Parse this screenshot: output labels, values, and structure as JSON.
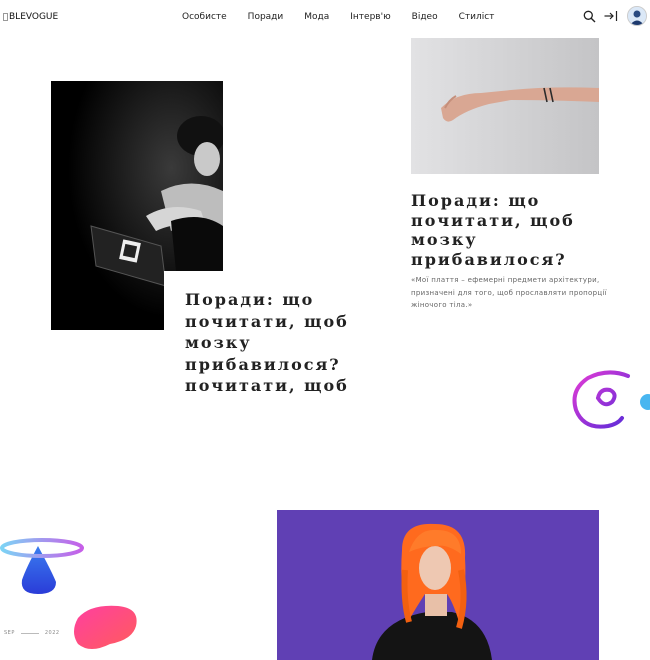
{
  "header": {
    "logo_alt": "BLEVOGUE",
    "nav": [
      "Особисте",
      "Поради",
      "Мода",
      "Інтерв'ю",
      "Відео",
      "Стиліст"
    ],
    "icons": [
      "search-icon",
      "login-icon",
      "avatar"
    ]
  },
  "articles": [
    {
      "title_lines": [
        "Поради: що",
        "почитати, щоб",
        "мозку",
        "прибавилося?",
        "почитати, щоб"
      ]
    },
    {
      "title_lines": [
        "Поради: що",
        "почитати, щоб",
        "мозку",
        "прибавилося?"
      ],
      "description": "«Мої плаття – ефемерні предмети архітектури, призначені для того, щоб прославляти пропорції жіночого тіла.»"
    }
  ],
  "pager": {
    "prev": "SEP",
    "next": "2022"
  }
}
